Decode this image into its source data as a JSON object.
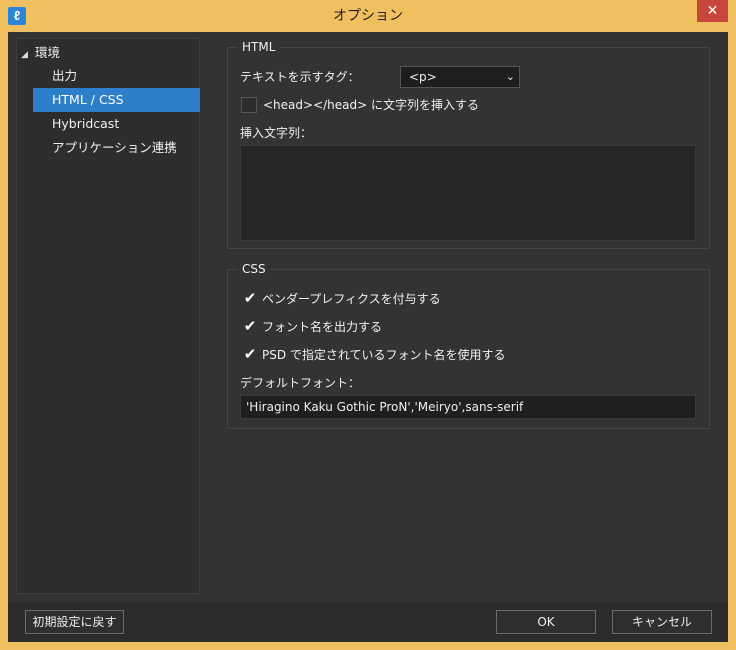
{
  "window": {
    "title": "オプション",
    "app_icon": "ℓ",
    "close_label": "✕"
  },
  "tree": {
    "root_label": "環境",
    "items": [
      {
        "label": "出力"
      },
      {
        "label": "HTML / CSS"
      },
      {
        "label": "Hybridcast"
      },
      {
        "label": "アプリケーション連携"
      }
    ]
  },
  "html_group": {
    "legend": "HTML",
    "tag_label": "テキストを示すタグ：",
    "tag_value": "<p>",
    "head_insert_label": "<head></head> に文字列を挿入する",
    "insert_string_label": "挿入文字列：",
    "insert_string_value": ""
  },
  "css_group": {
    "legend": "CSS",
    "vendor_prefix_label": "ベンダープレフィクスを付与する",
    "output_font_label": "フォント名を出力する",
    "psd_font_label": "PSD で指定されているフォント名を使用する",
    "default_font_label": "デフォルトフォント：",
    "default_font_value": "'Hiragino Kaku Gothic ProN','Meiryo',sans-serif"
  },
  "footer": {
    "reset_label": "初期設定に戻す",
    "ok_label": "OK",
    "cancel_label": "キャンセル"
  }
}
